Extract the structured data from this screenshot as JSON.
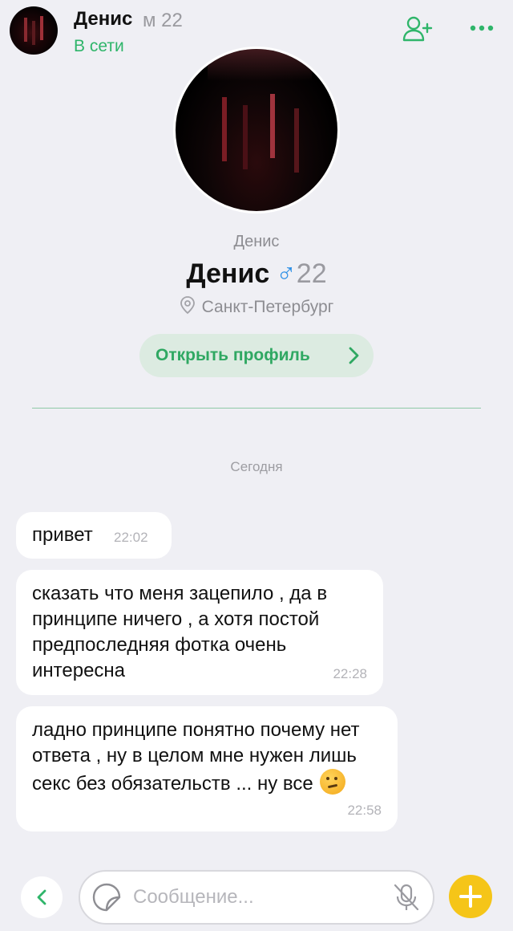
{
  "header": {
    "name": "Денис",
    "meta": "м 22",
    "status": "В сети",
    "add_user_icon": "add-user-icon",
    "more_icon": "more-dots-icon"
  },
  "profile": {
    "subname": "Денис",
    "name": "Денис",
    "gender_symbol": "♂",
    "age": "22",
    "city": "Санкт-Петербург",
    "open_profile_label": "Открыть профиль"
  },
  "chat": {
    "date_separator": "Сегодня",
    "messages": [
      {
        "text": "привет",
        "time": "22:02"
      },
      {
        "text": "сказать что меня зацепило , да в принципе  ничего , а хотя постой предпоследняя фотка очень интересна",
        "time": "22:28"
      },
      {
        "text": "ладно принципе понятно почему нет ответа , ну в целом мне нужен лишь секс без обязательств ... ну все",
        "emoji": "thinking-face",
        "time": "22:58"
      }
    ]
  },
  "composer": {
    "placeholder": "Сообщение...",
    "value": ""
  },
  "colors": {
    "accent_green": "#2fb56a",
    "gender_blue": "#2c8fe6",
    "plus_yellow": "#f5c518",
    "background": "#efeff4"
  }
}
